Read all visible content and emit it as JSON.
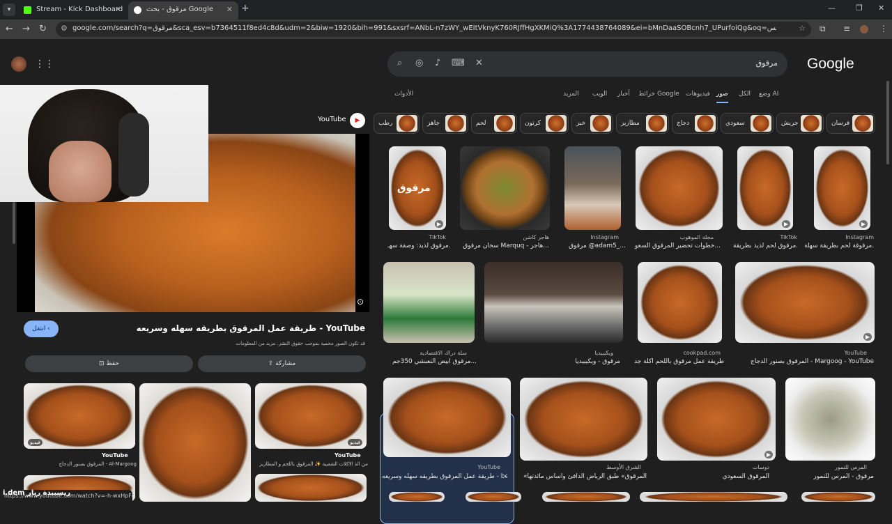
{
  "tabs": [
    {
      "title": "Stream - Kick Dashboard",
      "icon": "kick-icon",
      "color": "#53fc18"
    },
    {
      "title": "مرقوق - بحث Google",
      "icon": "google-icon",
      "color": "#ffffff"
    }
  ],
  "address_bar": {
    "url": "google.com/search?q=مرقوق&sca_esv=b7364511f8ed4c8d&udm=2&biw=1920&bih=991&sxsrf=ANbL-n7zWY_wEItVknyK760RJffHgXKMiQ%3A1774438764089&ei=bMnDaaSOBcnh7_UPurfoiQg&oq=عمان+بطاطس&gs_lp=Egtnd3Mtd2l6LWltZyIT2K..."
  },
  "google": {
    "logo": "Google",
    "query": "مرقوق",
    "filters": [
      "وضع AI",
      "الكل",
      "صور",
      "فيديوهات",
      "خرائط Google",
      "أخبار",
      "الويب",
      "المزيد"
    ],
    "active_filter": "صور",
    "tools_label": "الأدوات",
    "chips": [
      "فرسان",
      "جريش",
      "سعودي",
      "دجاج",
      "مطازيز",
      "خبز",
      "كرتون",
      "لحم",
      "جاهز",
      "رطب"
    ]
  },
  "results": [
    {
      "source": "Instagram",
      "title": "مرقوقة لحم بطريقة سهلة..."
    },
    {
      "source": "TikTok",
      "title": "مرقوق لحم لذيذ بطريقة..."
    },
    {
      "source": "مجلة الموهوب",
      "title": "خطوات تحضير المرقوق السعو..."
    },
    {
      "source": "Instagram",
      "title": "مرقوق @adam5_..."
    },
    {
      "source": "هاجر كاشن",
      "title": "سخان مرقوق Marquq - هاجر..."
    },
    {
      "source": "TikTok",
      "title": "مرقوق لذيذ: وصفة سهـ..."
    },
    {
      "source": "YouTube",
      "title": "المرقوق بصنور الدجاج - Margoog - YouTube"
    },
    {
      "source": "cookpad.com",
      "title": "طريقة عمل مرقوق باللحم اكلة جد..."
    },
    {
      "source": "ويكيبيديا",
      "title": "مرقوق - ويكيبيديا"
    },
    {
      "source": "سلة دراك الاقتصادية",
      "title": "مرقوق ابيض التعبشي 350جم..."
    },
    {
      "source": "المرس للتمور",
      "title": "مرقوق - المرس للتمور"
    },
    {
      "source": "دوسات",
      "title": "المرقوق السعودي"
    },
    {
      "source": "الشرق الأوسط",
      "title": "«المرقوق» طبق الرياض الدافئ وأساس مائدتها"
    },
    {
      "source": "YouTube",
      "title": "طريقة عمل المرقوق بطريقه سهله وسريعه - be..."
    }
  ],
  "overlay_image_text": "مرقوق",
  "panel": {
    "source": "YouTube",
    "title": "طريقة عمل المرقوق بطريقه سهله وسريعه - YouTube",
    "visit": "انتقل",
    "copyright": "قد تكون الصور محمية بموجب حقوق النشر. مزيد من المعلومات",
    "share": "مشاركة",
    "save": "حفظ",
    "related": [
      {
        "source": "YouTube",
        "title": "المرقوق بصنور الدجاج - Al-Margoog"
      },
      {
        "source": "YouTube",
        "title": ""
      },
      {
        "source": "YouTube",
        "title": "من الذ الاكلات الشعبية ✨ المرقوق باللحم و المطازيز"
      }
    ],
    "video_badge": "فيديو"
  },
  "status": {
    "url": "https://www.youtube.com/watch?v=-h-wxHpF6qU"
  },
  "stream_overlay": "i.dem ريسبيدة ريار"
}
